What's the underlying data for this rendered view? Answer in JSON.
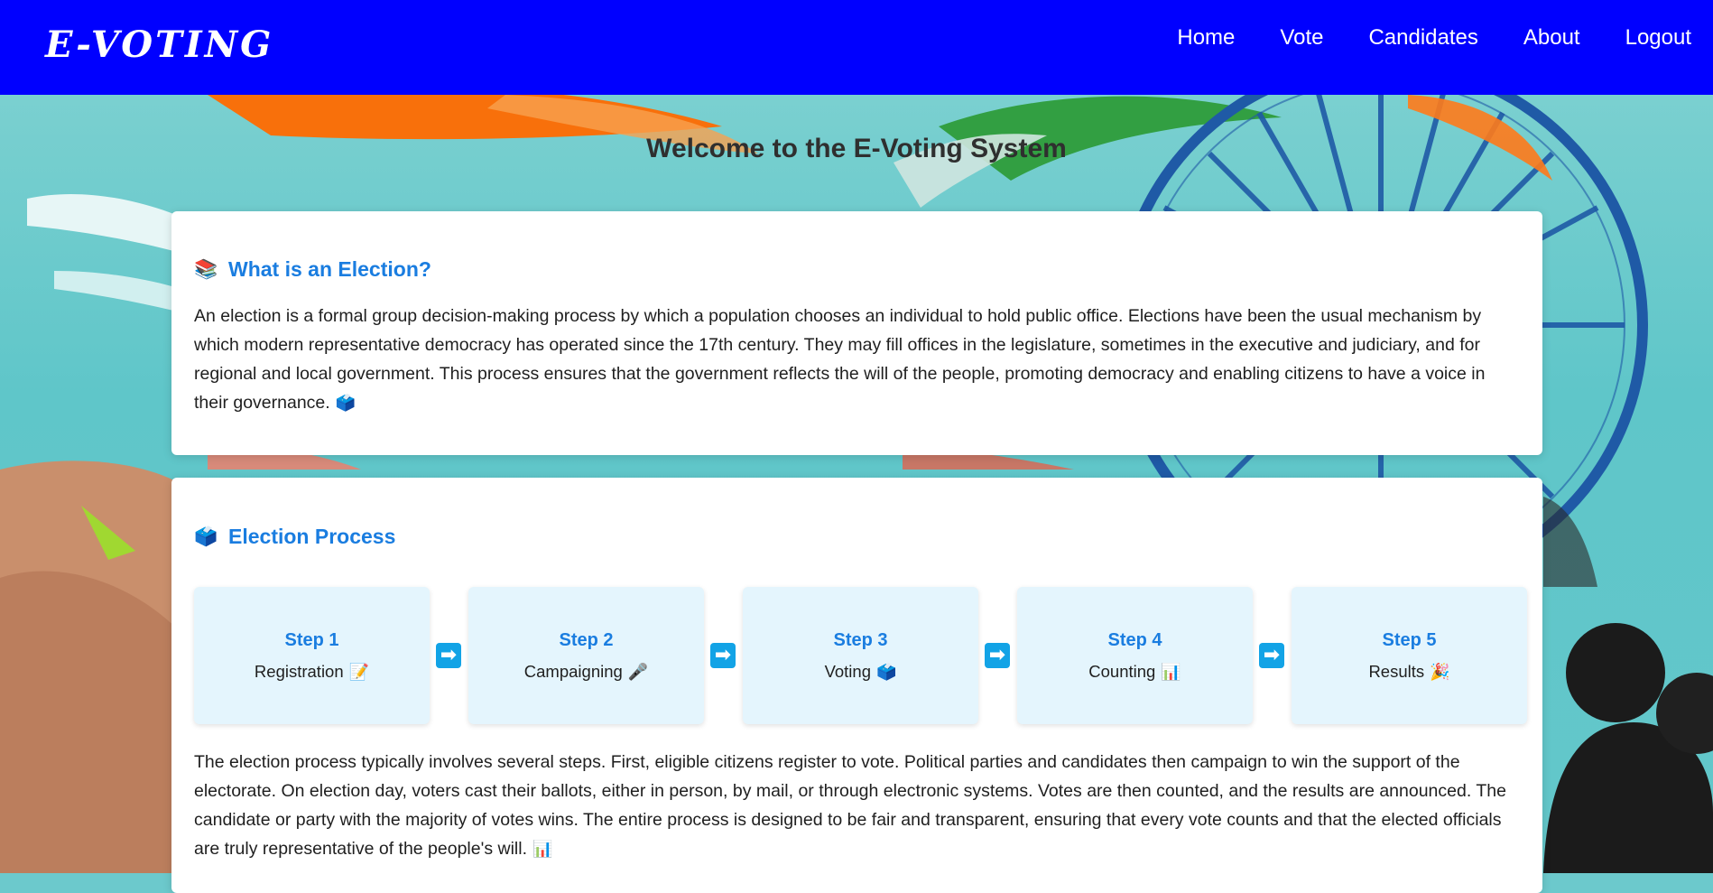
{
  "brand": "E-VOTING",
  "nav": {
    "items": [
      {
        "label": "Home"
      },
      {
        "label": "Vote"
      },
      {
        "label": "Candidates"
      },
      {
        "label": "About"
      },
      {
        "label": "Logout"
      }
    ]
  },
  "main": {
    "title": "Welcome to the E-Voting System",
    "election_section": {
      "icon": "📚",
      "heading": "What is an Election?",
      "text": "An election is a formal group decision-making process by which a population chooses an individual to hold public office. Elections have been the usual mechanism by which modern representative democracy has operated since the 17th century. They may fill offices in the legislature, sometimes in the executive and judiciary, and for regional and local government. This process ensures that the government reflects the will of the people, promoting democracy and enabling citizens to have a voice in their governance.",
      "text_emoji": "🗳️"
    },
    "process_section": {
      "icon": "🗳️",
      "heading": "Election Process",
      "arrow_glyph": "➡",
      "steps": [
        {
          "title": "Step 1",
          "label": "Registration",
          "emoji": "📝"
        },
        {
          "title": "Step 2",
          "label": "Campaigning",
          "emoji": "🎤"
        },
        {
          "title": "Step 3",
          "label": "Voting",
          "emoji": "🗳️"
        },
        {
          "title": "Step 4",
          "label": "Counting",
          "emoji": "📊"
        },
        {
          "title": "Step 5",
          "label": "Results",
          "emoji": "🎉"
        }
      ],
      "text": "The election process typically involves several steps. First, eligible citizens register to vote. Political parties and candidates then campaign to win the support of the electorate. On election day, voters cast their ballots, either in person, by mail, or through electronic systems. Votes are then counted, and the results are announced. The candidate or party with the majority of votes wins. The entire process is designed to be fair and transparent, ensuring that every vote counts and that the elected officials are truly representative of the people's will.",
      "text_emoji": "📊"
    }
  },
  "colors": {
    "navbar": "#0000ff",
    "accent": "#1a7de0",
    "step_bg": "#e4f5fd",
    "arrow_bg": "#12a3e6"
  }
}
